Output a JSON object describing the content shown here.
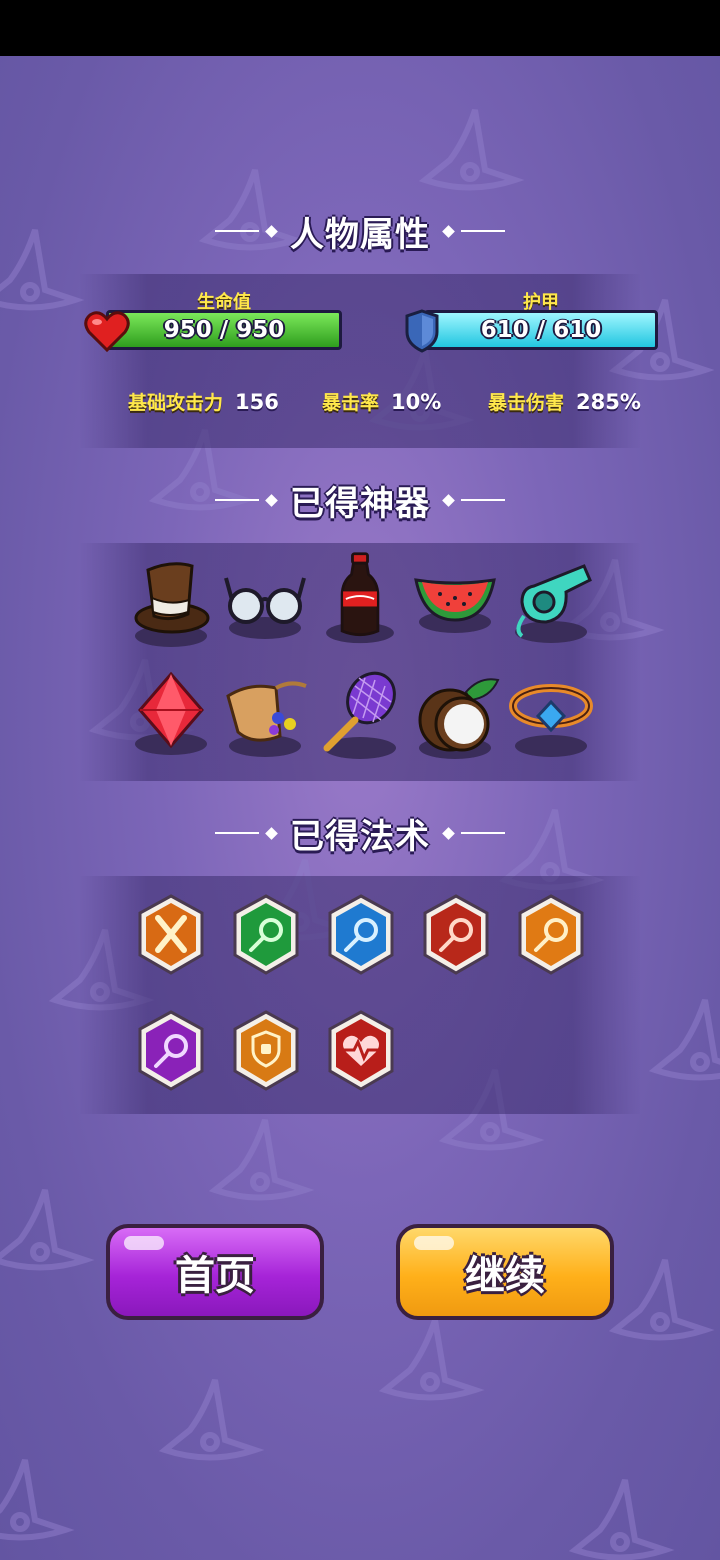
{
  "sections": {
    "attributes_title": "人物属性",
    "artifacts_title": "已得神器",
    "spells_title": "已得法术"
  },
  "health": {
    "label": "生命值",
    "value": "950 / 950",
    "fraction": 1.0,
    "color": "#3fbf2a"
  },
  "armor": {
    "label": "护甲",
    "value": "610 / 610",
    "fraction": 1.0,
    "color": "#2fd4ea"
  },
  "stats": [
    {
      "label": "基础攻击力",
      "value": "156"
    },
    {
      "label": "暴击率",
      "value": "10%"
    },
    {
      "label": "暴击伤害",
      "value": "285%"
    }
  ],
  "artifacts": [
    {
      "icon": "top-hat-icon"
    },
    {
      "icon": "glasses-icon"
    },
    {
      "icon": "cola-bottle-icon"
    },
    {
      "icon": "watermelon-icon"
    },
    {
      "icon": "whistle-icon"
    },
    {
      "icon": "red-gem-icon"
    },
    {
      "icon": "gem-bag-icon"
    },
    {
      "icon": "tennis-racket-icon"
    },
    {
      "icon": "coconut-icon"
    },
    {
      "icon": "ring-icon"
    }
  ],
  "spells": [
    {
      "icon": "crossed-swords-icon",
      "color": "#e07a1c"
    },
    {
      "icon": "green-comet-icon",
      "color": "#2fa040"
    },
    {
      "icon": "blue-comet-icon",
      "color": "#2a8ad6"
    },
    {
      "icon": "red-comet-icon",
      "color": "#c8331c"
    },
    {
      "icon": "orange-comet-icon",
      "color": "#e8801c"
    },
    {
      "icon": "purple-comet-icon",
      "color": "#9a2ec0"
    },
    {
      "icon": "shield-icon",
      "color": "#e08a1c"
    },
    {
      "icon": "heart-pulse-icon",
      "color": "#c8281c"
    }
  ],
  "buttons": {
    "home": "首页",
    "continue": "继续"
  },
  "colors": {
    "home_button": "#b030e0",
    "continue_button": "#ffb21a",
    "background": "#7a64b6"
  }
}
